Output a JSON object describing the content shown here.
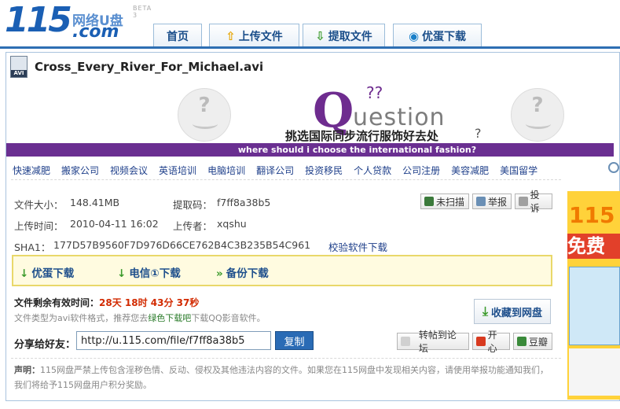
{
  "header": {
    "logo_num": "115",
    "logo_cn": "网络U盘",
    "logo_com": ".com",
    "logo_beta": "BETA 3",
    "nav": [
      {
        "label": "首页",
        "icon": ""
      },
      {
        "label": "上传文件",
        "icon": "upload-arrow-icon"
      },
      {
        "label": "提取文件",
        "icon": "download-arrow-icon"
      },
      {
        "label": "优蛋下载",
        "icon": "youdan-icon"
      }
    ]
  },
  "file": {
    "icon_label": "AVI",
    "name": "Cross_Every_River_For_Michael.avi"
  },
  "banner": {
    "q_letter": "Q",
    "q_rest": "uestion",
    "q_marks": "??",
    "face_mark": "?",
    "cn_text": "挑选国际同步流行服饰好去处",
    "cn_q": "?",
    "en_text": "where should i choose the international fashion?"
  },
  "links": [
    "快速减肥",
    "搬家公司",
    "视频会议",
    "英语培训",
    "电脑培训",
    "翻译公司",
    "投资移民",
    "个人贷款",
    "公司注册",
    "美容减肥",
    "美国留学"
  ],
  "info": {
    "size_label": "文件大小：",
    "size_value": "148.41MB",
    "code_label": "提取码：",
    "code_value": "f7ff8a38b5",
    "time_label": "上传时间：",
    "time_value": "2010-04-11 16:02",
    "uploader_label": "上传者：",
    "uploader_value": "xqshu",
    "sha_label": "SHA1：",
    "sha_value": "177D57B9560F7D976D66CE762B4C3B235B54C961",
    "verify_link": "校验软件下载",
    "scan_btn": "未扫描",
    "report_btn": "举报",
    "complain_btn": "投诉"
  },
  "downloads": {
    "youdan": "优蛋下载",
    "telecom": "电信①下载",
    "backup": "备份下载"
  },
  "remain": {
    "label": "文件剩余有效时间：",
    "value": "28天 18时 43分 37秒"
  },
  "filetype": {
    "pre": "文件类型为avi软件格式，推荐您去",
    "link": "绿色下载吧",
    "post": "下载QQ影音软件。"
  },
  "collect_btn": "收藏到网盘",
  "share": {
    "label": "分享给好友：",
    "url": "http://u.115.com/file/f7ff8a38b5",
    "copy": "复制",
    "forum": "转帖到论坛",
    "kaixin": "开心",
    "douban": "豆瓣"
  },
  "declaration": {
    "title": "声明：",
    "text": "115网盘严禁上传包含淫秽色情、反动、侵权及其他违法内容的文件。如果您在115网盘中发现相关内容，请使用举报功能通知我们，我们将给予115网盘用户积分奖励。"
  },
  "ad": {
    "num": "115",
    "free": "免费"
  },
  "colors": {
    "brand_blue": "#1a5fb4",
    "banner_purple": "#6a2f91",
    "timer_red": "#d22a00"
  }
}
